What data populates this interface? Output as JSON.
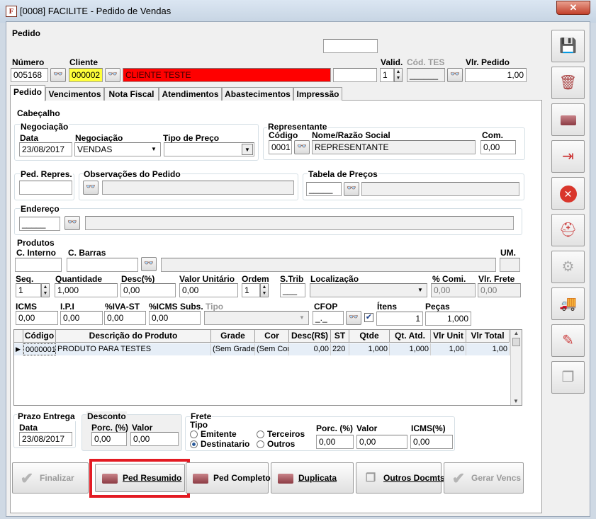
{
  "window": {
    "title": "[0008] FACILITE - Pedido de Vendas",
    "app_icon": "F",
    "close_glyph": "✕"
  },
  "header": {
    "section": "Pedido",
    "numero_label": "Número",
    "numero_value": "005168",
    "cliente_label": "Cliente",
    "cliente_code": "000002",
    "cliente_name": "CLIENTE TESTE",
    "valid_label": "Valid.",
    "valid_value": "1",
    "cod_tes_label": "Cód. TES",
    "cod_tes_value": "______",
    "vlr_pedido_label": "Vlr. Pedido",
    "vlr_pedido_value": "1,00"
  },
  "tabs": [
    "Pedido",
    "Vencimentos",
    "Nota Fiscal",
    "Atendimentos",
    "Abastecimentos",
    "Impressão"
  ],
  "cabecalho": {
    "title": "Cabeçalho",
    "negociacao_group": "Negociação",
    "data_label": "Data",
    "data_value": "23/08/2017",
    "negociacao_label": "Negociação",
    "negociacao_value": "VENDAS",
    "tipo_preco_label": "Tipo de Preço",
    "tipo_preco_value": "",
    "representante_group": "Representante",
    "codigo_label": "Código",
    "rep_code": "0001",
    "nome_label": "Nome/Razão Social",
    "rep_name": "REPRESENTANTE",
    "com_label": "Com.",
    "com_value": "0,00",
    "ped_repres_label": "Ped. Repres.",
    "obs_label": "Observações do Pedido",
    "tabela_label": "Tabela de Preços",
    "tabela_code": "_____",
    "endereco_label": "Endereço",
    "endereco_code": "_____"
  },
  "produtos": {
    "title": "Produtos",
    "c_interno_label": "C. Interno",
    "c_barras_label": "C. Barras",
    "um_label": "UM.",
    "seq_label": "Seq.",
    "seq_value": "1",
    "quantidade_label": "Quantidade",
    "quantidade_value": "1,000",
    "desc_label": "Desc(%)",
    "desc_value": "0,00",
    "valor_unit_label": "Valor Unitário",
    "valor_unit_value": "0,00",
    "ordem_label": "Ordem",
    "ordem_value": "1",
    "strib_label": "S.Trib",
    "strib_value": "___",
    "localizacao_label": "Localização",
    "comi_label": "% Comi.",
    "comi_value": "0,00",
    "frete_label": "Vlr. Frete",
    "frete_value": "0,00",
    "icms_label": "ICMS",
    "icms_value": "0,00",
    "ipi_label": "I.P.I",
    "ipi_value": "0,00",
    "iva_label": "%IVA-ST",
    "iva_value": "0,00",
    "icms_subs_label": "%ICMS Subs.",
    "icms_subs_value": "0,00",
    "tipo_label": "Tipo",
    "cfop_label": "CFOP",
    "cfop_value": "_._",
    "itens_label": "Ítens",
    "itens_value": "1",
    "pecas_label": "Peças",
    "pecas_value": "1,000"
  },
  "grid": {
    "columns": [
      "Código",
      "Descrição do Produto",
      "Grade",
      "Cor",
      "Desc(R$)",
      "ST",
      "Qtde",
      "Qt. Atd.",
      "Vlr Unit",
      "Vlr Total"
    ],
    "rows": [
      [
        "0000001",
        "PRODUTO PARA TESTES",
        "(Sem Grade",
        "(Sem Cor)",
        "0,00",
        "220",
        "1,000",
        "1,000",
        "1,00",
        "1,00"
      ]
    ]
  },
  "footer": {
    "prazo_label": "Prazo Entrega",
    "prazo_data_label": "Data",
    "prazo_data_value": "23/08/2017",
    "desconto_label": "Desconto",
    "porc_label": "Porc. (%)",
    "valor_label": "Valor",
    "desc_porc_value": "0,00",
    "desc_valor_value": "0,00",
    "frete_label": "Frete",
    "tipo_label": "Tipo",
    "emitente": "Emitente",
    "destinatario": "Destinatario",
    "terceiros": "Terceiros",
    "outros": "Outros",
    "frete_porc_value": "0,00",
    "frete_valor_value": "0,00",
    "icms_label": "ICMS(%)",
    "icms_value": "0,00"
  },
  "actions": {
    "finalizar": "Finalizar",
    "ped_resumido": "Ped Resumido",
    "ped_completo": "Ped Completo",
    "duplicata": "Duplicata",
    "outros_docmts": "Outros Docmts",
    "gerar_vencs": "Gerar Vencs"
  },
  "colors": {
    "highlight": "#e31b23",
    "cliente_name_bg": "#ff0000",
    "cliente_code_bg": "#ffff3a"
  }
}
